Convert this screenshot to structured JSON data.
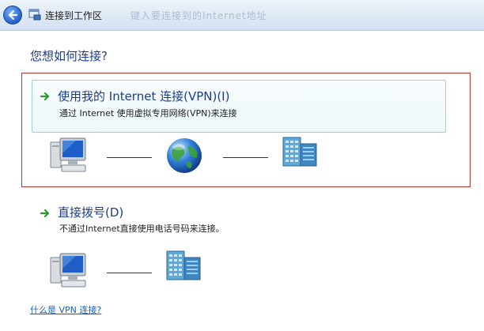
{
  "window": {
    "title": "连接到工作区",
    "title_ghost": "键入要连接到的Internet地址"
  },
  "main": {
    "heading": "您想如何连接?",
    "options": [
      {
        "title": "使用我的 Internet 连接(VPN)(I)",
        "description": "通过 Internet 使用虚拟专用网络(VPN)来连接",
        "selected": true
      },
      {
        "title": "直接拨号(D)",
        "description": "不通过Internet直接使用电话号码来连接。",
        "selected": false
      }
    ],
    "help_link": "什么是 VPN 连接?"
  },
  "colors": {
    "heading": "#1c3c8c",
    "selection_border": "#b5372f",
    "option_border": "#9fd3d8",
    "link": "#1560bd",
    "arrow": "#2e9b2e"
  },
  "icons": [
    "back-arrow-icon",
    "network-window-icon",
    "green-arrow-icon",
    "computer-icon",
    "globe-icon",
    "server-building-icon"
  ]
}
